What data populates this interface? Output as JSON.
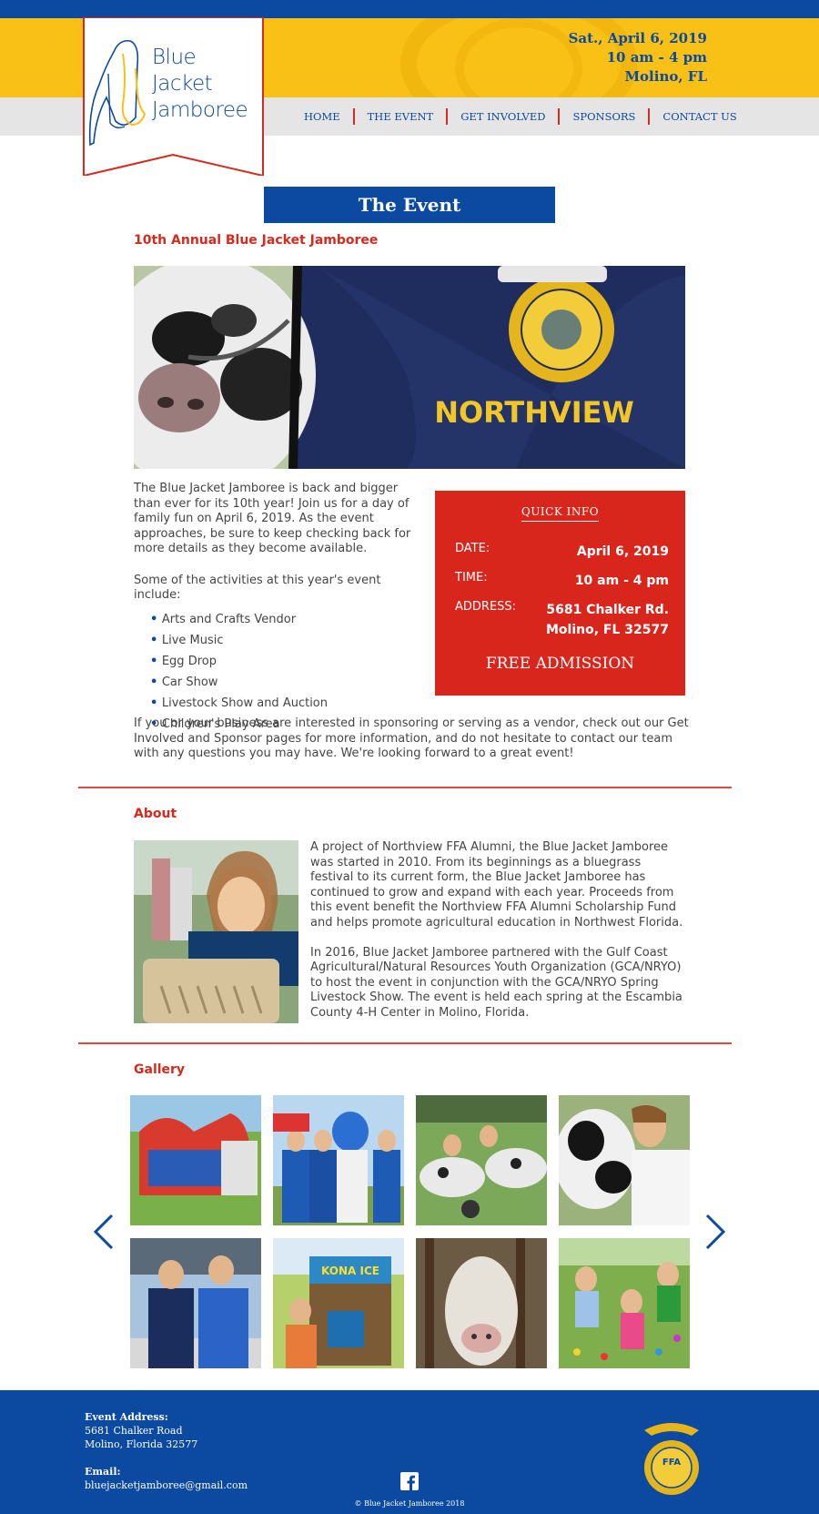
{
  "brand": {
    "logo_lines": [
      "Blue",
      "Jacket",
      "Jamboree"
    ],
    "colors": {
      "blue": "#0b4aa0",
      "yellow": "#f9c016",
      "red": "#d52b1e"
    }
  },
  "header": {
    "date": "Sat., April 6, 2019",
    "time": "10 am - 4 pm",
    "location": "Molino, FL"
  },
  "nav": {
    "items": [
      "HOME",
      "THE EVENT",
      "GET INVOLVED",
      "SPONSORS",
      "CONTACT US"
    ]
  },
  "page": {
    "title": "The Event"
  },
  "event": {
    "heading": "10th Annual Blue Jacket Jamboree",
    "intro": "The Blue Jacket Jamboree is back and bigger than ever for its 10th year! Join us for a day of family fun on April 6, 2019. As the event approaches, be sure to keep checking back for more details as they become available.",
    "activities_intro": "Some of the activities at this year's event include:",
    "activities": [
      "Arts and Crafts Vendor",
      "Live Music",
      "Egg Drop",
      "Car Show",
      "Livestock Show and Auction",
      "Children's Play Area"
    ],
    "closing": "If you or your business are interested in sponsoring or serving as a vendor, check out our Get Involved and Sponsor pages for more information, and do not hesitate to contact our team with any questions you may have. We're looking forward to a great event!",
    "hero_jacket_text": "NORTHVIEW"
  },
  "quick_info": {
    "title": "QUICK INFO",
    "date_label": "DATE:",
    "date_value": "April 6, 2019",
    "time_label": "TIME:",
    "time_value": "10 am - 4 pm",
    "address_label": "ADDRESS:",
    "address_line1": "5681 Chalker Rd.",
    "address_line2": "Molino, FL 32577",
    "admission": "FREE ADMISSION"
  },
  "about": {
    "heading": "About",
    "p1": "A project of Northview FFA Alumni, the Blue Jacket Jamboree was started in 2010. From its beginnings as a bluegrass festival to its current form, the Blue Jacket Jamboree has continued to grow and expand with each year. Proceeds from this event benefit the Northview FFA Alumni Scholarship Fund and helps promote agricultural education in Northwest Florida.",
    "p2": "In 2016, Blue Jacket Jamboree partnered with the Gulf Coast Agricultural/Natural Resources Youth Organization (GCA/NRYO) to host the event in conjunction with the GCA/NRYO Spring Livestock Show. The event is held each spring at the Escambia County 4-H Center in Molino, Florida."
  },
  "gallery": {
    "heading": "Gallery",
    "kona_sign": "KONA ICE"
  },
  "footer": {
    "address_label": "Event Address:",
    "address_line1": "5681 Chalker Road",
    "address_line2": "Molino, Florida 32577",
    "email_label": "Email:",
    "email": "bluejacketjamboree@gmail.com",
    "copyright": "© Blue Jacket Jamboree 2018",
    "emblem_text": "FFA"
  }
}
